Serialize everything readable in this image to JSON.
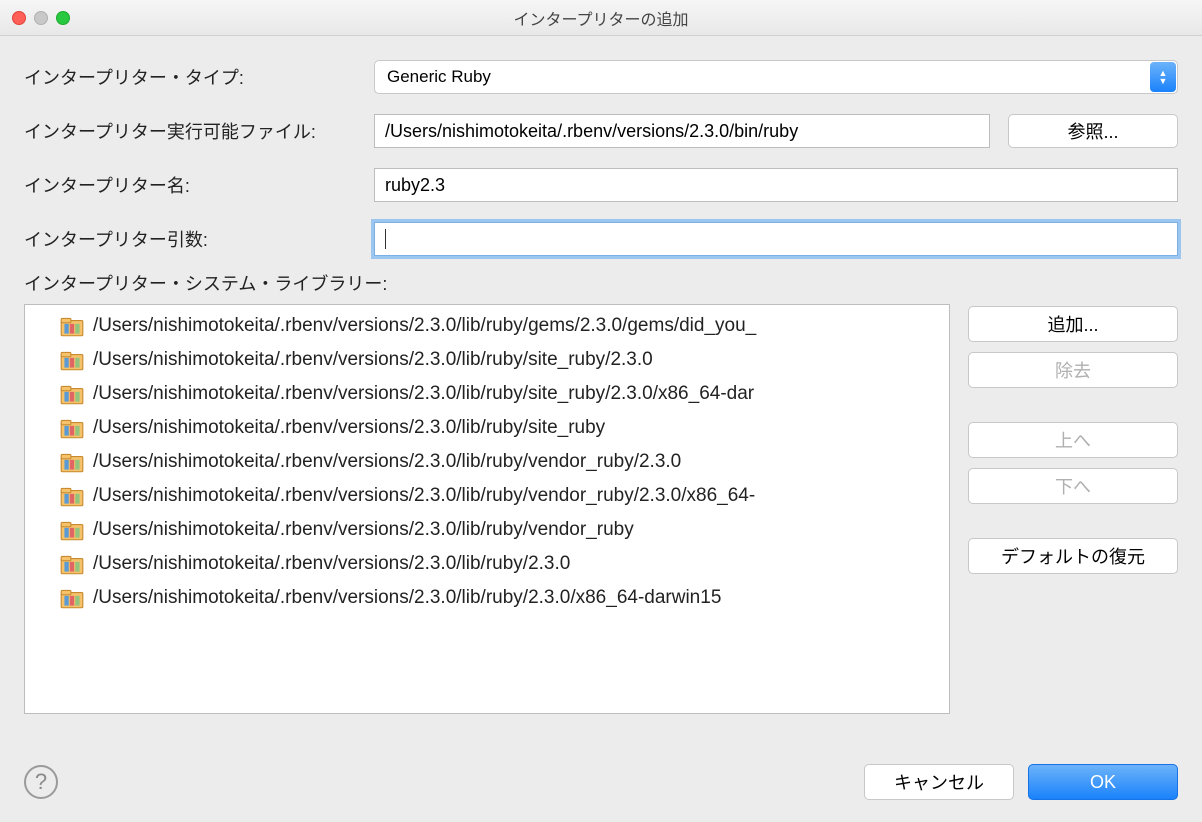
{
  "title": "インタープリターの追加",
  "labels": {
    "type": "インタープリター・タイプ:",
    "executable": "インタープリター実行可能ファイル:",
    "name": "インタープリター名:",
    "args": "インタープリター引数:",
    "libraries": "インタープリター・システム・ライブラリー:"
  },
  "fields": {
    "type_value": "Generic Ruby",
    "executable_value": "/Users/nishimotokeita/.rbenv/versions/2.3.0/bin/ruby",
    "name_value": "ruby2.3",
    "args_value": ""
  },
  "buttons": {
    "browse": "参照...",
    "add": "追加...",
    "remove": "除去",
    "up": "上へ",
    "down": "下へ",
    "restore": "デフォルトの復元",
    "cancel": "キャンセル",
    "ok": "OK",
    "help": "?"
  },
  "libraries": [
    "/Users/nishimotokeita/.rbenv/versions/2.3.0/lib/ruby/gems/2.3.0/gems/did_you_",
    "/Users/nishimotokeita/.rbenv/versions/2.3.0/lib/ruby/site_ruby/2.3.0",
    "/Users/nishimotokeita/.rbenv/versions/2.3.0/lib/ruby/site_ruby/2.3.0/x86_64-dar",
    "/Users/nishimotokeita/.rbenv/versions/2.3.0/lib/ruby/site_ruby",
    "/Users/nishimotokeita/.rbenv/versions/2.3.0/lib/ruby/vendor_ruby/2.3.0",
    "/Users/nishimotokeita/.rbenv/versions/2.3.0/lib/ruby/vendor_ruby/2.3.0/x86_64-",
    "/Users/nishimotokeita/.rbenv/versions/2.3.0/lib/ruby/vendor_ruby",
    "/Users/nishimotokeita/.rbenv/versions/2.3.0/lib/ruby/2.3.0",
    "/Users/nishimotokeita/.rbenv/versions/2.3.0/lib/ruby/2.3.0/x86_64-darwin15"
  ]
}
